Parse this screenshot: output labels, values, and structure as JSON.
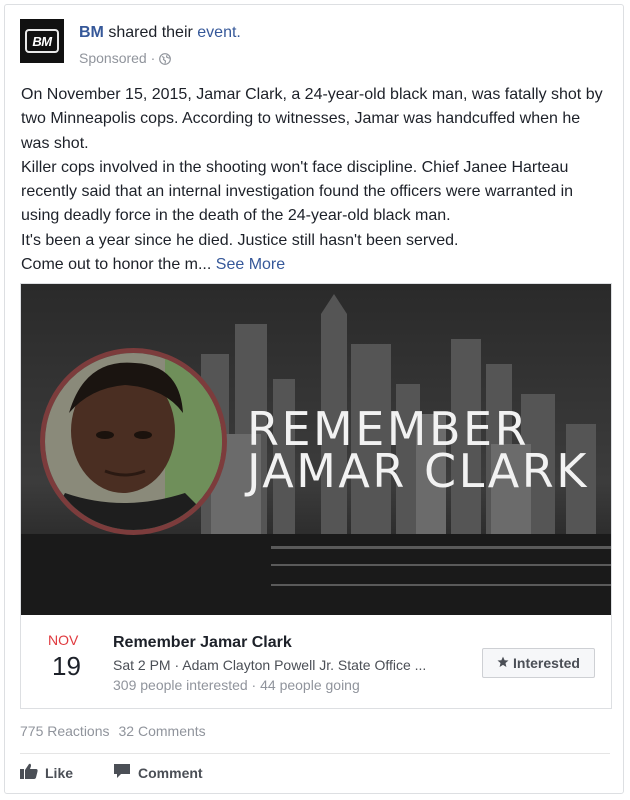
{
  "post": {
    "page_name": "BM",
    "avatar_text": "BM",
    "shared_text": " shared their ",
    "event_link": "event.",
    "sponsored": "Sponsored ·",
    "body": [
      "On November 15, 2015, Jamar Clark, a 24-year-old black man, was fatally shot by two Minneapolis cops. According to witnesses, Jamar was handcuffed when he was shot.",
      "Killer cops involved in the shooting won't face discipline. Chief Janee Harteau recently said that an internal investigation found the officers were warranted in using deadly force in the death of the 24-year-old black man.",
      "It's been a year since he died. Justice still hasn't been served."
    ],
    "truncated": "Come out to honor the m...",
    "see_more": "See More"
  },
  "event": {
    "cover_line1": "REMEMBER",
    "cover_line2": "JAMAR CLARK",
    "month": "NOV",
    "day": "19",
    "title": "Remember Jamar Clark",
    "detail": "Sat 2 PM · Adam Clayton Powell Jr. State Office ...",
    "stats": "309 people interested · 44 people going",
    "interested_label": "Interested"
  },
  "footer": {
    "reactions": "775 Reactions",
    "comments": "32 Comments",
    "like_label": "Like",
    "comment_label": "Comment"
  },
  "colors": {
    "link": "#365899",
    "month": "#e0393e",
    "muted": "#90949c",
    "portrait_ring": "#7c3c3c"
  },
  "icons": [
    "globe-icon",
    "star-icon",
    "like-icon",
    "comment-icon"
  ]
}
